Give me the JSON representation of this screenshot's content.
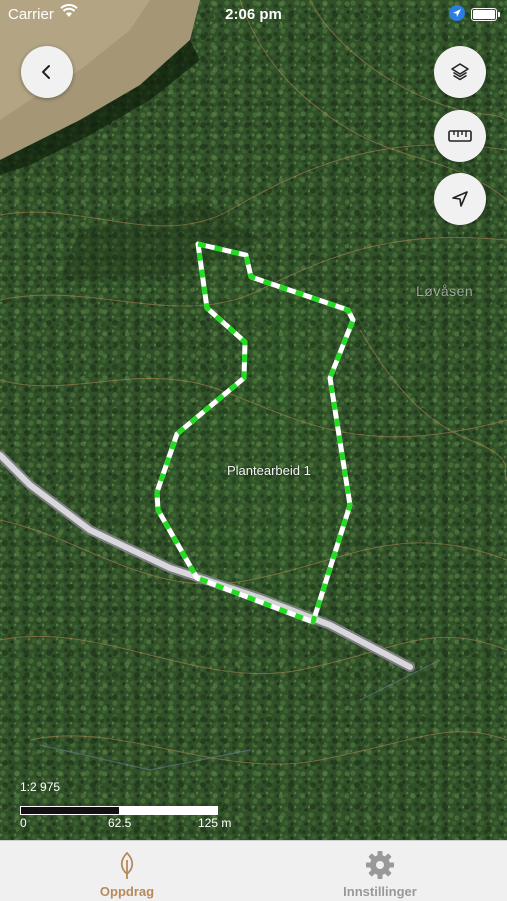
{
  "status_bar": {
    "carrier": "Carrier",
    "time": "2:06 pm"
  },
  "map": {
    "area_label": "Plantearbeid 1",
    "place_label": "Løvåsen",
    "polygon_color": "#22dd22",
    "road_color": "#d8d8dc"
  },
  "buttons": {
    "back_icon": "chevron-left-icon",
    "layers_icon": "layers-icon",
    "measure_icon": "ruler-icon",
    "locate_icon": "navigation-arrow-icon"
  },
  "scale": {
    "ratio": "1:2 975",
    "tick_0": "0",
    "tick_mid": "62.5",
    "tick_end": "125 m"
  },
  "tab_bar": {
    "tabs": [
      {
        "label": "Oppdrag",
        "icon": "leaf-icon",
        "active": true
      },
      {
        "label": "Innstillinger",
        "icon": "gear-icon",
        "active": false
      }
    ]
  },
  "colors": {
    "active_tab": "#b88a5a",
    "inactive_tab": "#999999"
  }
}
